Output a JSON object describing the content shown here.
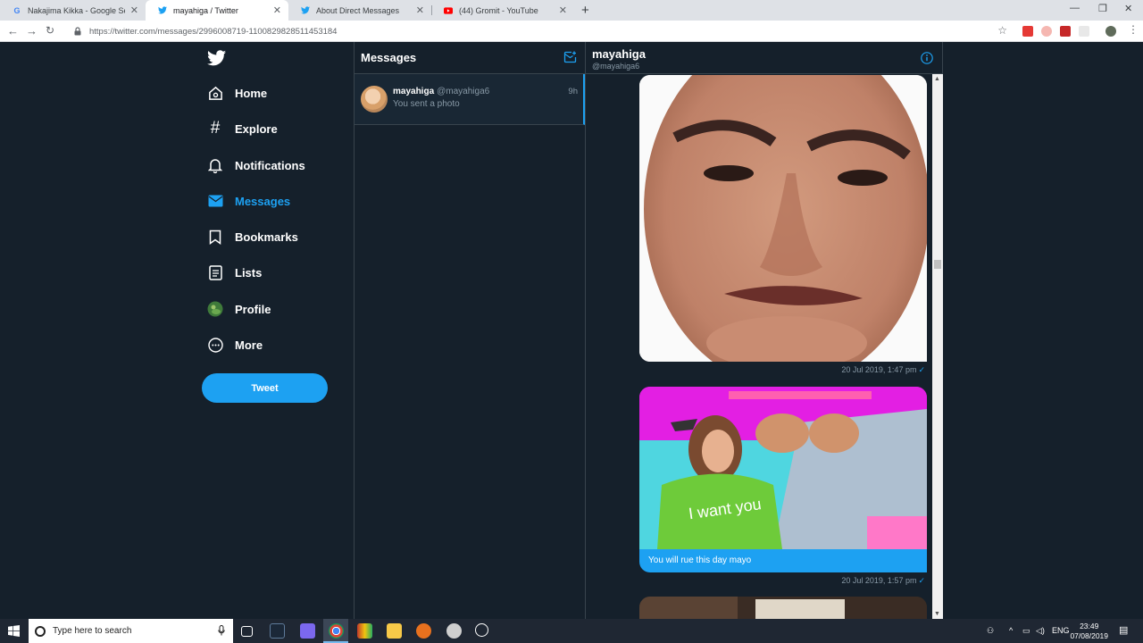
{
  "browser": {
    "tabs": [
      {
        "title": "Nakajima Kikka - Google Search",
        "icon": "google-icon",
        "active": false
      },
      {
        "title": "mayahiga / Twitter",
        "icon": "twitter-icon",
        "active": true
      },
      {
        "title": "About Direct Messages",
        "icon": "twitter-icon",
        "active": false
      },
      {
        "title": "(44) Gromit - YouTube",
        "icon": "youtube-icon",
        "active": false
      }
    ],
    "url": "https://twitter.com/messages/2996008719-1100829828511453184"
  },
  "sidebar": {
    "items": [
      {
        "label": "Home",
        "icon": "home-icon"
      },
      {
        "label": "Explore",
        "icon": "hashtag-icon"
      },
      {
        "label": "Notifications",
        "icon": "bell-icon"
      },
      {
        "label": "Messages",
        "icon": "envelope-icon"
      },
      {
        "label": "Bookmarks",
        "icon": "bookmark-icon"
      },
      {
        "label": "Lists",
        "icon": "list-icon"
      },
      {
        "label": "Profile",
        "icon": "profile-avatar"
      },
      {
        "label": "More",
        "icon": "more-icon"
      }
    ],
    "tweet_label": "Tweet"
  },
  "messages": {
    "title": "Messages",
    "conversation": {
      "name": "mayahiga",
      "handle": "@mayahiga6",
      "time": "9h",
      "preview": "You sent a photo"
    }
  },
  "chat": {
    "name": "mayahiga",
    "handle": "@mayahiga6",
    "timestamp1": "20 Jul 2019, 1:47 pm",
    "message": "You will rue this day mayo",
    "timestamp2": "20 Jul 2019, 1:57 pm",
    "photo_text": "I want you"
  },
  "taskbar": {
    "search_placeholder": "Type here to search",
    "lang": "ENG",
    "time": "23:49",
    "date": "07/08/2019"
  },
  "colors": {
    "twitter_blue": "#1da1f2",
    "background": "#15202b",
    "border": "#38444d",
    "muted": "#8899a6"
  }
}
